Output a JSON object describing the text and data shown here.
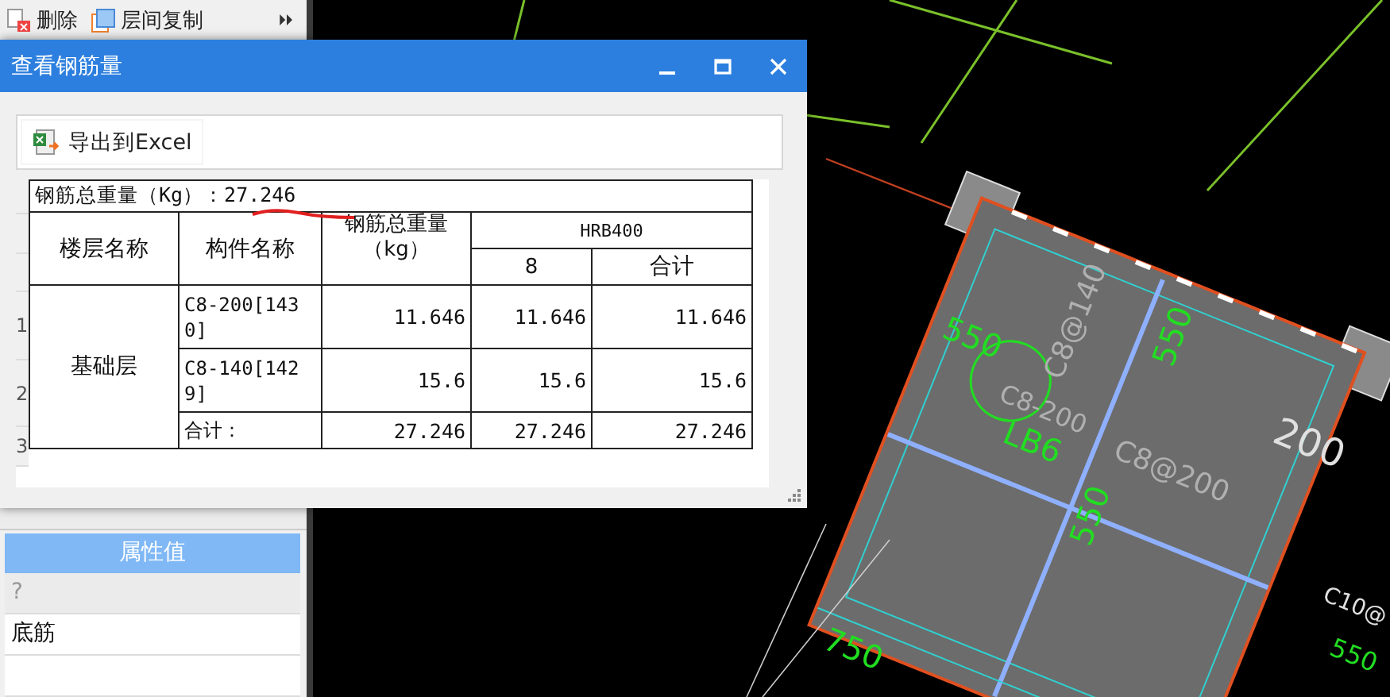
{
  "toolbar": {
    "items": [
      {
        "kind": "delete",
        "label": "删除"
      },
      {
        "kind": "copy",
        "label": "层间复制"
      }
    ]
  },
  "properties": {
    "header": "属性值",
    "rows": [
      {
        "value": "?",
        "kind": "hint"
      },
      {
        "value": "底筋",
        "kind": "value"
      }
    ]
  },
  "cad_labels": [
    {
      "text": "550",
      "color": "#22dd22"
    },
    {
      "text": "550",
      "color": "#22dd22"
    },
    {
      "text": "550",
      "color": "#22dd22"
    },
    {
      "text": "200",
      "color": "#e0e0e0"
    },
    {
      "text": "C8@200",
      "color": "#b0b0b0"
    },
    {
      "text": "C8@140",
      "color": "#b0b0b0"
    },
    {
      "text": "C8-200",
      "color": "#b0b0b0"
    },
    {
      "text": "LB6",
      "color": "#22dd22"
    },
    {
      "text": "750",
      "color": "#22dd22"
    },
    {
      "text": "550",
      "color": "#22dd22"
    },
    {
      "text": "C10@",
      "color": "#e0e0e0"
    }
  ],
  "dialog": {
    "title": "查看钢筋量",
    "export_button": "导出到Excel",
    "summary": "钢筋总重量（Kg）：27.246",
    "columns": {
      "floor": "楼层名称",
      "component": "构件名称",
      "total": "钢筋总重量（kg）",
      "grade": "HRB400",
      "diameter": "8",
      "subtotal": "合计"
    },
    "floor_name": "基础层",
    "rows": [
      {
        "number": "1",
        "component": "C8-200[1430]",
        "total": "11.646",
        "diameter": "11.646",
        "subtotal": "11.646"
      },
      {
        "number": "2",
        "component": "C8-140[1429]",
        "total": "15.6",
        "diameter": "15.6",
        "subtotal": "15.6"
      },
      {
        "number": "3",
        "component": "合计：",
        "total": "27.246",
        "diameter": "27.246",
        "subtotal": "27.246"
      }
    ]
  }
}
